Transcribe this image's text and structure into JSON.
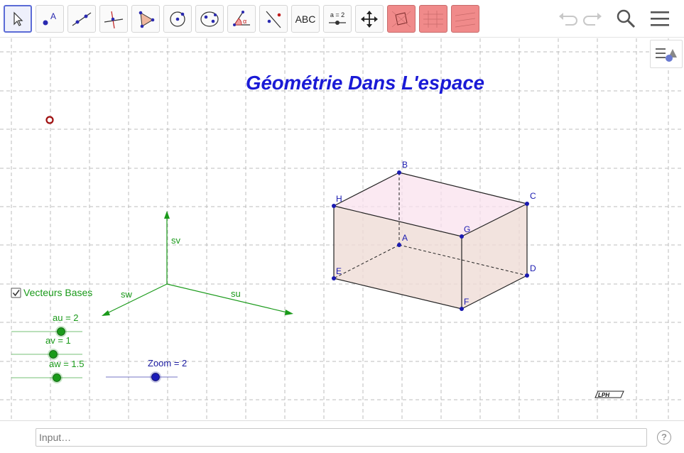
{
  "toolbar": {
    "tools": [
      {
        "name": "move-tool",
        "icon": "arrow-pointer-icon",
        "active": true
      },
      {
        "name": "point-tool",
        "icon": "point-icon",
        "label": "A"
      },
      {
        "name": "line-tool",
        "icon": "line-through-points-icon"
      },
      {
        "name": "perpendicular-line-tool",
        "icon": "perpendicular-icon"
      },
      {
        "name": "polygon-tool",
        "icon": "polygon-icon"
      },
      {
        "name": "circle-tool",
        "icon": "circle-center-point-icon"
      },
      {
        "name": "ellipse-tool",
        "icon": "ellipse-icon"
      },
      {
        "name": "angle-tool",
        "icon": "angle-icon",
        "label": "α"
      },
      {
        "name": "reflect-tool",
        "icon": "reflect-about-line-icon"
      },
      {
        "name": "text-tool",
        "icon": "text-icon",
        "label": "ABC"
      },
      {
        "name": "slider-tool",
        "icon": "slider-icon",
        "label": "a = 2"
      },
      {
        "name": "move-graphics-view-tool",
        "icon": "move-view-icon"
      },
      {
        "name": "view-tool-1",
        "icon": "pink-rectangle-icon"
      },
      {
        "name": "view-tool-2",
        "icon": "pink-rectangle-icon"
      },
      {
        "name": "view-tool-3",
        "icon": "pink-rectangle-icon"
      }
    ],
    "undo": "undo-icon",
    "redo": "redo-icon",
    "search": "search-icon",
    "menu": "hamburger-menu-icon"
  },
  "graphics": {
    "title": "Géométrie Dans L'espace",
    "title_color": "#1a1ad6",
    "stylebar_icon": "style-bar-toggle-icon",
    "checkbox": {
      "label": "Vecteurs Bases",
      "checked": true
    },
    "axes": {
      "sv": "sv",
      "sw": "sw",
      "su": "su",
      "color": "#1a9a1a"
    },
    "sliders": [
      {
        "name": "au",
        "label": "au = 2",
        "value": 2,
        "color": "#1a9a1a"
      },
      {
        "name": "av",
        "label": "av = 1",
        "value": 1,
        "color": "#1a9a1a"
      },
      {
        "name": "aw",
        "label": "aw = 1.5",
        "value": 1.5,
        "color": "#1a9a1a"
      },
      {
        "name": "zoom",
        "label": "Zoom = 2",
        "value": 2,
        "color": "#1a1aa0"
      }
    ],
    "points": [
      "A",
      "B",
      "C",
      "D",
      "E",
      "F",
      "G",
      "H"
    ],
    "point_color": "#1a1ab0",
    "logo": "LPH",
    "origin_marker_color": "#a01010"
  },
  "input": {
    "placeholder": "Input…",
    "help": "?"
  }
}
